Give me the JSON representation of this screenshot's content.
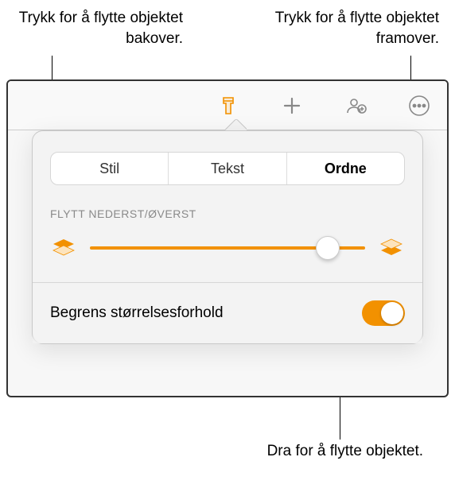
{
  "callouts": {
    "back": "Trykk for å flytte objektet bakover.",
    "front": "Trykk for å flytte objektet framover.",
    "drag": "Dra for å flytte objektet."
  },
  "toolbar": {
    "format_icon": "format-brush",
    "add_icon": "plus",
    "collab_icon": "person-badge",
    "more_icon": "ellipsis"
  },
  "tabs": {
    "style": "Stil",
    "text": "Tekst",
    "arrange": "Ordne"
  },
  "section": {
    "move_label": "FLYTT NEDERST/ØVERST"
  },
  "constrain": {
    "label": "Begrens størrelsesforhold"
  },
  "colors": {
    "accent": "#f29100"
  }
}
